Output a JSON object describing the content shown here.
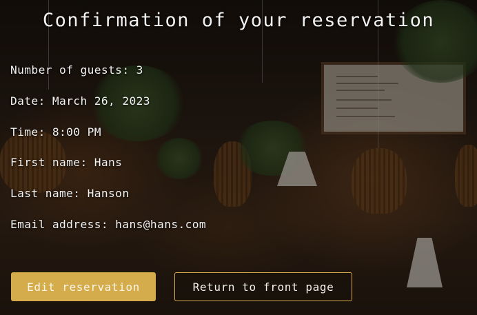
{
  "page": {
    "title": "Confirmation of your reservation"
  },
  "reservation": {
    "guests": "Number of guests: 3",
    "date": "Date: March 26, 2023",
    "time": "Time: 8:00 PM",
    "first_name": "First name: Hans",
    "last_name": "Last name: Hanson",
    "email": "Email address: hans@hans.com"
  },
  "actions": {
    "edit_label": "Edit reservation",
    "return_label": "Return to front page"
  },
  "colors": {
    "accent": "#d4ac4b",
    "text": "#f2f2f2"
  }
}
